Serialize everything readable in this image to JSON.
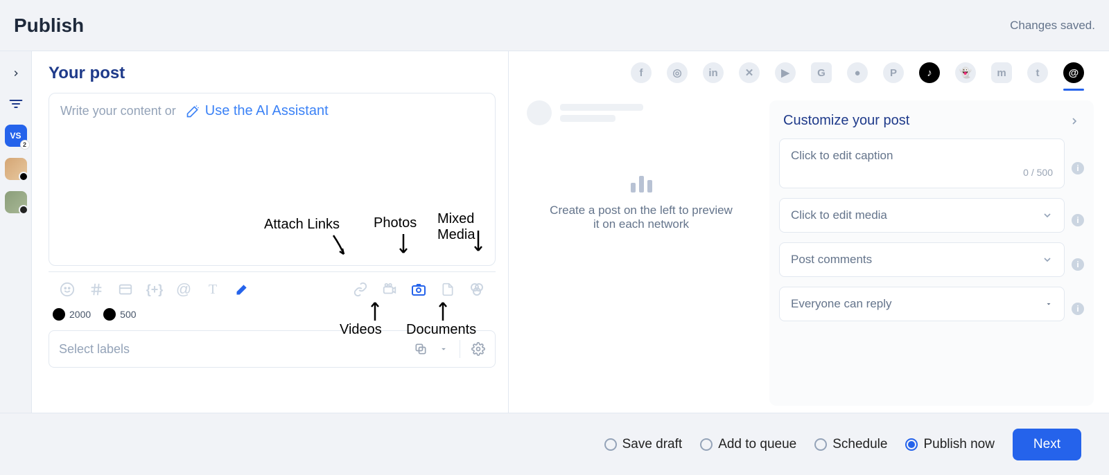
{
  "header": {
    "title": "Publish",
    "status": "Changes saved."
  },
  "sidebar": {
    "avatar_initials": "VS",
    "avatar_badge": "2"
  },
  "composer": {
    "heading": "Your post",
    "placeholder": "Write your content or",
    "ai_label": "Use the AI Assistant",
    "counts": {
      "tiktok": "2000",
      "threads": "500"
    },
    "labels_placeholder": "Select labels"
  },
  "annotations": {
    "attach_links": "Attach Links",
    "photos": "Photos",
    "mixed_media": "Mixed Media",
    "videos": "Videos",
    "documents": "Documents"
  },
  "networks": [
    "facebook",
    "instagram",
    "linkedin",
    "x",
    "youtube",
    "google",
    "reddit",
    "pinterest",
    "tiktok",
    "snapchat",
    "mastodon",
    "tumblr",
    "threads"
  ],
  "preview": {
    "empty_line1": "Create a post on the left to preview",
    "empty_line2": "it on each network"
  },
  "customize": {
    "title": "Customize your post",
    "caption_placeholder": "Click to edit caption",
    "caption_counter": "0 / 500",
    "media_placeholder": "Click to edit media",
    "comments_placeholder": "Post comments",
    "reply_setting": "Everyone can reply"
  },
  "footer": {
    "save_draft": "Save draft",
    "add_queue": "Add to queue",
    "schedule": "Schedule",
    "publish_now": "Publish now",
    "next": "Next"
  }
}
